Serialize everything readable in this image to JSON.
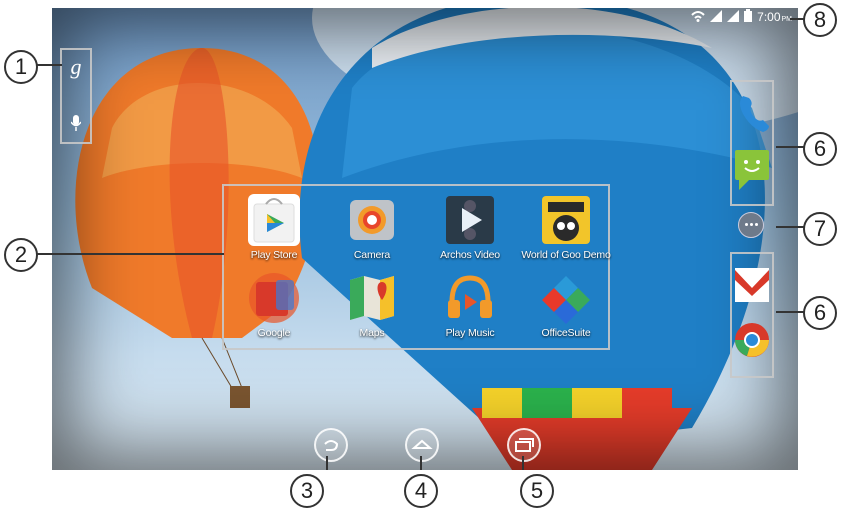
{
  "status": {
    "time": "7:00",
    "ampm": "PM"
  },
  "apps": [
    {
      "label": "Play Store"
    },
    {
      "label": "Camera"
    },
    {
      "label": "Archos Video"
    },
    {
      "label": "World of Goo Demo"
    },
    {
      "label": "Google"
    },
    {
      "label": "Maps"
    },
    {
      "label": "Play Music"
    },
    {
      "label": "OfficeSuite"
    }
  ],
  "search_widget": {
    "g": "g"
  },
  "callouts": [
    "1",
    "2",
    "3",
    "4",
    "5",
    "6",
    "7",
    "6",
    "8"
  ],
  "colors": {
    "wallpaper_sky": "#8db2d6",
    "balloon_blue": "#1f7fc6",
    "balloon_orange": "#f07a2a"
  }
}
